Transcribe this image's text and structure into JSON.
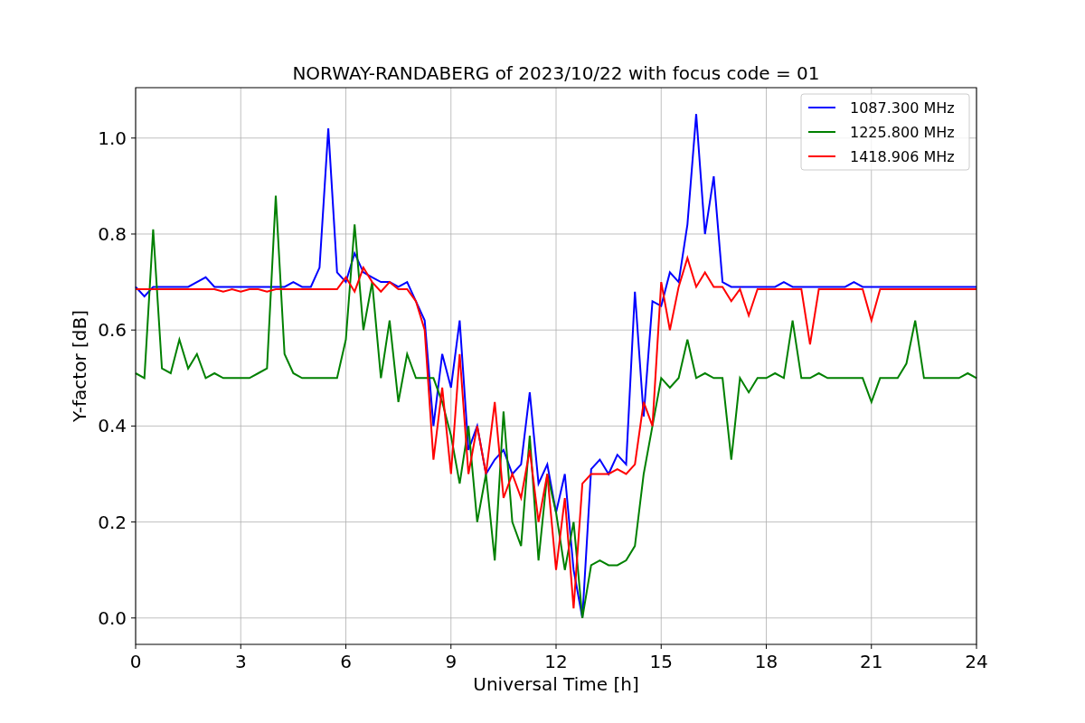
{
  "figure": {
    "chart_data": {
      "type": "line",
      "title": "NORWAY-RANDABERG of 2023/10/22 with focus code = 01",
      "xlabel": "Universal Time [h]",
      "ylabel": "Y-factor [dB]",
      "x": [
        0,
        0.25,
        0.5,
        0.75,
        1,
        1.25,
        1.5,
        1.75,
        2,
        2.25,
        2.5,
        2.75,
        3,
        3.25,
        3.5,
        3.75,
        4,
        4.25,
        4.5,
        4.75,
        5,
        5.25,
        5.5,
        5.75,
        6,
        6.25,
        6.5,
        6.75,
        7,
        7.25,
        7.5,
        7.75,
        8,
        8.25,
        8.5,
        8.75,
        9,
        9.25,
        9.5,
        9.75,
        10,
        10.25,
        10.5,
        10.75,
        11,
        11.25,
        11.5,
        11.75,
        12,
        12.25,
        12.5,
        12.75,
        13,
        13.25,
        13.5,
        13.75,
        14,
        14.25,
        14.5,
        14.75,
        15,
        15.25,
        15.5,
        15.75,
        16,
        16.25,
        16.5,
        16.75,
        17,
        17.25,
        17.5,
        17.75,
        18,
        18.25,
        18.5,
        18.75,
        19,
        19.25,
        19.5,
        19.75,
        20,
        20.25,
        20.5,
        20.75,
        21,
        21.25,
        21.5,
        21.75,
        22,
        22.25,
        22.5,
        22.75,
        23,
        23.25,
        23.5,
        23.75,
        24
      ],
      "series": [
        {
          "name": "1087.300 MHz",
          "color": "#0000ff",
          "values": [
            0.69,
            0.67,
            0.69,
            0.69,
            0.69,
            0.69,
            0.69,
            0.7,
            0.71,
            0.69,
            0.69,
            0.69,
            0.69,
            0.69,
            0.69,
            0.69,
            0.69,
            0.69,
            0.7,
            0.69,
            0.69,
            0.73,
            1.02,
            0.72,
            0.7,
            0.76,
            0.72,
            0.71,
            0.7,
            0.7,
            0.69,
            0.7,
            0.66,
            0.62,
            0.4,
            0.55,
            0.48,
            0.62,
            0.35,
            0.4,
            0.3,
            0.33,
            0.35,
            0.3,
            0.32,
            0.47,
            0.28,
            0.32,
            0.22,
            0.3,
            0.1,
            0.0,
            0.31,
            0.33,
            0.3,
            0.34,
            0.32,
            0.68,
            0.42,
            0.66,
            0.65,
            0.72,
            0.7,
            0.82,
            1.05,
            0.8,
            0.92,
            0.7,
            0.69,
            0.69,
            0.69,
            0.69,
            0.69,
            0.69,
            0.7,
            0.69,
            0.69,
            0.69,
            0.69,
            0.69,
            0.69,
            0.69,
            0.7,
            0.69,
            0.69,
            0.69,
            0.69,
            0.69,
            0.69,
            0.69,
            0.69,
            0.69,
            0.69,
            0.69,
            0.69,
            0.69,
            0.69
          ]
        },
        {
          "name": "1225.800 MHz",
          "color": "#008000",
          "values": [
            0.51,
            0.5,
            0.81,
            0.52,
            0.51,
            0.58,
            0.52,
            0.55,
            0.5,
            0.51,
            0.5,
            0.5,
            0.5,
            0.5,
            0.51,
            0.52,
            0.88,
            0.55,
            0.51,
            0.5,
            0.5,
            0.5,
            0.5,
            0.5,
            0.58,
            0.82,
            0.6,
            0.7,
            0.5,
            0.62,
            0.45,
            0.55,
            0.5,
            0.5,
            0.5,
            0.45,
            0.38,
            0.28,
            0.4,
            0.2,
            0.3,
            0.12,
            0.43,
            0.2,
            0.15,
            0.38,
            0.12,
            0.3,
            0.22,
            0.1,
            0.2,
            0.0,
            0.11,
            0.12,
            0.11,
            0.11,
            0.12,
            0.15,
            0.3,
            0.4,
            0.5,
            0.48,
            0.5,
            0.58,
            0.5,
            0.51,
            0.5,
            0.5,
            0.33,
            0.5,
            0.47,
            0.5,
            0.5,
            0.51,
            0.5,
            0.62,
            0.5,
            0.5,
            0.51,
            0.5,
            0.5,
            0.5,
            0.5,
            0.5,
            0.45,
            0.5,
            0.5,
            0.5,
            0.53,
            0.62,
            0.5,
            0.5,
            0.5,
            0.5,
            0.5,
            0.51,
            0.5
          ]
        },
        {
          "name": "1418.906 MHz",
          "color": "#ff0000",
          "values": [
            0.685,
            0.685,
            0.685,
            0.685,
            0.685,
            0.685,
            0.685,
            0.685,
            0.685,
            0.685,
            0.68,
            0.685,
            0.68,
            0.685,
            0.685,
            0.68,
            0.685,
            0.685,
            0.685,
            0.685,
            0.685,
            0.685,
            0.685,
            0.685,
            0.71,
            0.68,
            0.73,
            0.7,
            0.68,
            0.7,
            0.685,
            0.685,
            0.66,
            0.6,
            0.33,
            0.48,
            0.3,
            0.55,
            0.3,
            0.4,
            0.3,
            0.45,
            0.25,
            0.3,
            0.25,
            0.35,
            0.2,
            0.3,
            0.1,
            0.25,
            0.02,
            0.28,
            0.3,
            0.3,
            0.3,
            0.31,
            0.3,
            0.32,
            0.45,
            0.4,
            0.7,
            0.6,
            0.69,
            0.75,
            0.69,
            0.72,
            0.69,
            0.69,
            0.66,
            0.685,
            0.63,
            0.685,
            0.685,
            0.685,
            0.685,
            0.685,
            0.685,
            0.57,
            0.685,
            0.685,
            0.685,
            0.685,
            0.685,
            0.685,
            0.62,
            0.685,
            0.685,
            0.685,
            0.685,
            0.685,
            0.685,
            0.685,
            0.685,
            0.685,
            0.685,
            0.685,
            0.685
          ]
        }
      ],
      "grid": true,
      "legend": "upper right",
      "xlim": [
        0,
        24
      ],
      "ylim": [
        -0.055,
        1.105
      ],
      "xticks": [
        0,
        3,
        6,
        9,
        12,
        15,
        18,
        21,
        24
      ],
      "yticks": [
        {
          "value": 0,
          "label": "0.0"
        },
        {
          "value": 0.2,
          "label": "0.2"
        },
        {
          "value": 0.4,
          "label": "0.4"
        },
        {
          "value": 0.6,
          "label": "0.6"
        },
        {
          "value": 0.8,
          "label": "0.8"
        },
        {
          "value": 1,
          "label": "1.0"
        }
      ]
    }
  }
}
